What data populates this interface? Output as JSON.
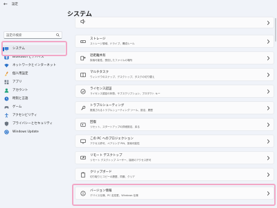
{
  "window": {
    "title": "設定",
    "back_icon": "back-arrow-icon"
  },
  "search": {
    "placeholder": "設定の検索",
    "icon": "search-icon"
  },
  "sidebar": {
    "items": [
      {
        "label": "システム",
        "icon": "monitor-icon",
        "selected": true
      },
      {
        "label": "Bluetooth とデバイス",
        "icon": "bluetooth-icon"
      },
      {
        "label": "ネットワークとインターネット",
        "icon": "wifi-icon"
      },
      {
        "label": "個人用設定",
        "icon": "brush-icon"
      },
      {
        "label": "アプリ",
        "icon": "apps-icon"
      },
      {
        "label": "アカウント",
        "icon": "account-icon"
      },
      {
        "label": "時刻と言語",
        "icon": "globe-clock-icon"
      },
      {
        "label": "ゲーム",
        "icon": "gamepad-icon"
      },
      {
        "label": "アクセシビリティ",
        "icon": "accessibility-icon"
      },
      {
        "label": "プライバシーとセキュリティ",
        "icon": "shield-icon"
      },
      {
        "label": "Windows Update",
        "icon": "update-icon"
      }
    ]
  },
  "main": {
    "title": "システム",
    "cards": [
      {
        "title": "",
        "desc": "",
        "icon": "sound-icon"
      },
      {
        "title": "ストレージ",
        "desc": "ストレージ領域、ドライブ、構成ルール",
        "icon": "storage-icon"
      },
      {
        "title": "近距離共有",
        "desc": "探索可能性、受信したファイルの場所",
        "icon": "nearby-share-icon"
      },
      {
        "title": "マルチタスク",
        "desc": "ウィンドウのスナップ、デスクトップ、タスクの切り替え",
        "icon": "multitasking-icon"
      },
      {
        "title": "ライセンス認証",
        "desc": "ライセンス認証の状態、サブスクリプション、プロダクト キー",
        "icon": "activation-icon"
      },
      {
        "title": "トラブルシューティング",
        "desc": "推奨されるトラブルシューティング ツール、設定、履歴",
        "icon": "troubleshoot-icon"
      },
      {
        "title": "回復",
        "desc": "リセット、スタートアップの詳細設定、戻る",
        "icon": "recovery-icon"
      },
      {
        "title": "この PC へのプロジェクション",
        "desc": "アクセス許可、ペアリング PIN、探索可能性",
        "icon": "projection-icon"
      },
      {
        "title": "リモート デスクトップ",
        "desc": "リモート デスクトップ ユーザー、接続のアクセス許可",
        "icon": "remote-desktop-icon"
      },
      {
        "title": "クリップボード",
        "desc": "切り取りとコピーの履歴、同期、クリア",
        "icon": "clipboard-icon"
      },
      {
        "title": "バージョン情報",
        "desc": "デバイス仕様、PC 名変更、Windows 仕様",
        "icon": "info-icon"
      }
    ]
  },
  "colors": {
    "accent": "#0067c0",
    "highlight": "#f2a7c6",
    "background": "#f0f3f9",
    "card": "#fbfbfc"
  }
}
